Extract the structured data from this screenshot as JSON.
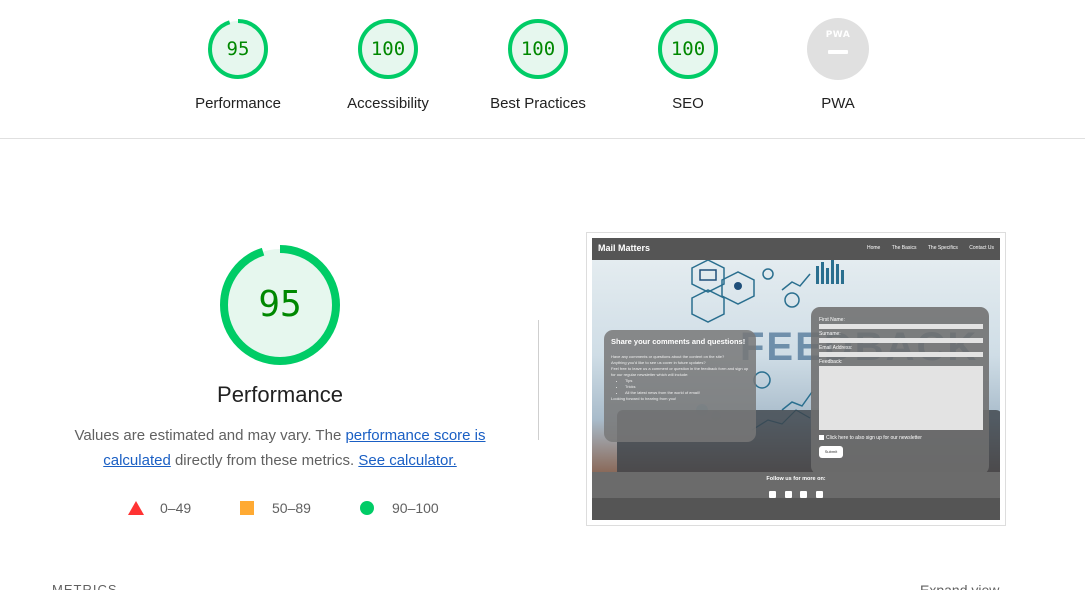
{
  "categories": [
    {
      "label": "Performance",
      "score": "95",
      "ratio": 0.95,
      "color": "#00cc66"
    },
    {
      "label": "Accessibility",
      "score": "100",
      "ratio": 1.0,
      "color": "#00cc66"
    },
    {
      "label": "Best Practices",
      "score": "100",
      "ratio": 1.0,
      "color": "#00cc66"
    },
    {
      "label": "SEO",
      "score": "100",
      "ratio": 1.0,
      "color": "#00cc66"
    },
    {
      "label": "PWA",
      "badge": "PWA"
    }
  ],
  "performance": {
    "score": "95",
    "ratio": 0.95,
    "title": "Performance",
    "desc_prefix": "Values are estimated and may vary. The ",
    "link_score": "performance score is calculated",
    "desc_middle": " directly from these metrics. ",
    "link_calc": "See calculator."
  },
  "legend": [
    {
      "range": "0–49",
      "color": "#ff3333"
    },
    {
      "range": "50–89",
      "color": "#ffaa33"
    },
    {
      "range": "90–100",
      "color": "#00cc66"
    }
  ],
  "screenshot": {
    "brand": "Mail Matters",
    "nav": [
      "Home",
      "The Basics",
      "The Specifics",
      "Contact Us"
    ],
    "heading": "Share your comments and questions!",
    "paragraph1": "Have any comments or questions about the content on the site?",
    "paragraph2": "Anything you'd like to see us cover in future updates?",
    "paragraph3": "Feel free to leave us a comment or question in the feedback form and sign up for our regular newsletter which will include:",
    "list": [
      "Tips",
      "Tricks",
      "All the latest news from the world of email!"
    ],
    "paragraph4": "Looking forward to hearing from you!",
    "form_labels": [
      "First Name:",
      "Surname:",
      "Email Address:",
      "Feedback:"
    ],
    "checkbox_label": "Click here to also sign up for our newsletter",
    "submit": "Submit",
    "footer": "Follow us for more on:",
    "hero_word": "FEEDBACK"
  },
  "bottom": {
    "metrics": "METRICS",
    "expand": "Expand view"
  }
}
